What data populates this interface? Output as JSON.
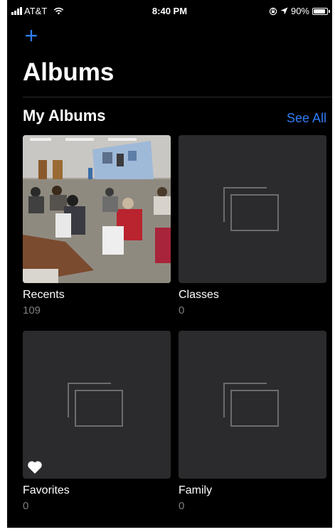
{
  "status_bar": {
    "carrier": "AT&T",
    "time": "8:40 PM",
    "battery": "90%",
    "battery_level": 0.9,
    "icons": [
      "signal-icon",
      "wifi-icon",
      "lock-rotation-icon",
      "location-arrow-icon",
      "battery-icon"
    ]
  },
  "header": {
    "add_icon": "+",
    "title": "Albums"
  },
  "section": {
    "title": "My Albums",
    "see_all": "See All"
  },
  "albums": [
    {
      "name": "Recents",
      "count": "109",
      "thumbnail": "photo-of-classroom-presentation"
    },
    {
      "name": "Classes",
      "count": "0",
      "thumbnail": "empty-album-icon"
    },
    {
      "name": "Favorites",
      "count": "0",
      "thumbnail": "empty-album-icon",
      "badge": "heart-icon"
    },
    {
      "name": "Family",
      "count": "0",
      "thumbnail": "empty-album-icon"
    }
  ],
  "colors": {
    "background": "#000000",
    "accent": "#2f7df6",
    "tile": "#2b2b2d",
    "secondary_text": "#7e7e82"
  }
}
